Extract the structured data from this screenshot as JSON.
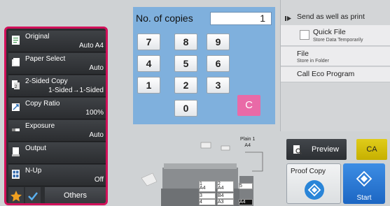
{
  "functions": [
    {
      "name": "Original",
      "value": "Auto  A4",
      "icon": "original-icon"
    },
    {
      "name": "Paper Select",
      "value": "Auto",
      "icon": "paper-select-icon"
    },
    {
      "name": "2-Sided Copy",
      "value": "1-Sided→1-Sided",
      "icon": "two-sided-copy-icon"
    },
    {
      "name": "Copy Ratio",
      "value": "100%",
      "icon": "copy-ratio-icon"
    },
    {
      "name": "Exposure",
      "value": "Auto",
      "icon": "exposure-icon"
    },
    {
      "name": "Output",
      "value": "",
      "icon": "output-icon"
    },
    {
      "name": "N-Up",
      "value": "Off",
      "icon": "n-up-icon"
    }
  ],
  "bottom": {
    "others_label": "Others"
  },
  "copies": {
    "label": "No. of copies",
    "value": "1"
  },
  "keypad": {
    "keys": [
      "7",
      "8",
      "9",
      "4",
      "5",
      "6",
      "1",
      "2",
      "3",
      "0"
    ],
    "clear": "C"
  },
  "right_panel": {
    "send_label": "Send as well as print",
    "quick_file": {
      "title": "Quick File",
      "sub": "Store Data Temporarily"
    },
    "file": {
      "title": "File",
      "sub": "Store in Folder"
    },
    "eco": {
      "title": "Call Eco Program"
    }
  },
  "buttons": {
    "preview": "Preview",
    "ca": "CA",
    "proof": "Proof Copy",
    "start": "Start"
  },
  "machine": {
    "plain_paper": "Plain 1",
    "plain_size": "A4",
    "trays": [
      {
        "num": "1",
        "size": "A4"
      },
      {
        "num": "2",
        "size": "A4"
      },
      {
        "num": "3",
        "size": "B4"
      },
      {
        "num": "4",
        "size": "A3"
      },
      {
        "num": "5",
        "size": ""
      },
      {
        "num": "",
        "size": "A4"
      }
    ]
  },
  "colors": {
    "accent_border": "#d2105a",
    "keypad_bg": "#7fb0dd",
    "start_blue": "#1c66c3",
    "ca_yellow": "#d4bd00",
    "clear_pink": "#e96aa7",
    "star_orange": "#f0a020",
    "check_blue": "#5ab0f0"
  }
}
